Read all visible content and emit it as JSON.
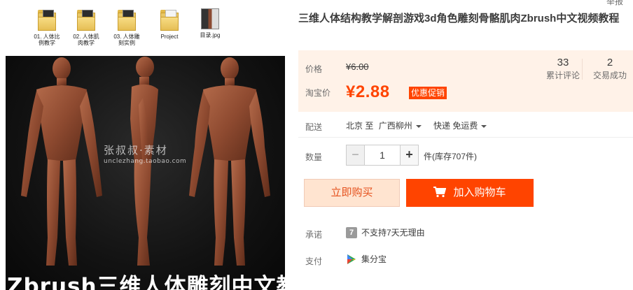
{
  "desktop_files": [
    {
      "label": "01. 人体比\n例教学",
      "type": "folder-dark"
    },
    {
      "label": "02. 人体肌\n肉教学",
      "type": "folder-dark"
    },
    {
      "label": "03. 人体雕\n刻实例",
      "type": "folder-dark"
    },
    {
      "label": "Project",
      "type": "folder-light"
    },
    {
      "label": "目录.jpg",
      "type": "image"
    }
  ],
  "photo": {
    "watermark_main": "张叔叔·素材",
    "watermark_url": "unclezhang.taobao.com",
    "banner": "Zbrush三维人体雕刻中文教学"
  },
  "top_link": "举报",
  "title": "三维人体结构教学解剖游戏3d角色雕刻骨骼肌肉Zbrush中文视频教程",
  "price": {
    "label": "价格",
    "original": "¥6.00",
    "promo_label": "淘宝价",
    "promo_value": "¥2.88",
    "promo_tag": "优惠促销"
  },
  "stats": {
    "reviews_count": "33",
    "reviews_label": "累计评论",
    "deals_count": "2",
    "deals_label": "交易成功"
  },
  "shipping": {
    "label": "配送",
    "from": "北京 至",
    "to": "广西柳州",
    "method": "快递 免运费"
  },
  "quantity": {
    "label": "数量",
    "value": "1",
    "minus": "−",
    "plus": "+",
    "stock_text": "件(库存707件)"
  },
  "actions": {
    "buy_now": "立即购买",
    "add_to_cart": "加入购物车"
  },
  "promise": {
    "label": "承诺",
    "badge": "7",
    "text": "不支持7天无理由"
  },
  "payment": {
    "label": "支付",
    "text": "集分宝"
  },
  "colors": {
    "accent": "#ff4400",
    "price_panel_bg": "#fff2e8",
    "buy_now_bg": "#ffe4d0"
  }
}
